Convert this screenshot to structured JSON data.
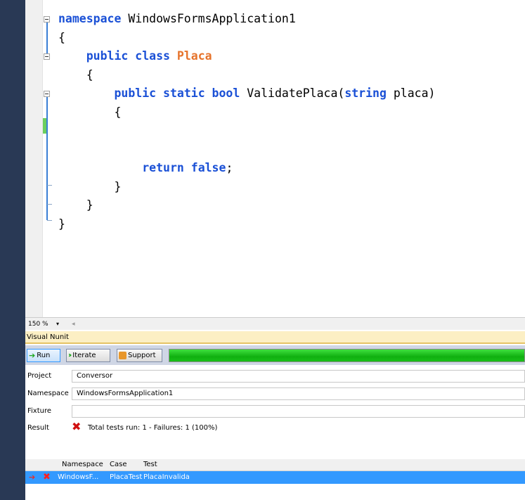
{
  "editor": {
    "code_lines": [
      [
        "namespace",
        " WindowsFormsApplication1"
      ],
      [
        "{"
      ],
      [
        "public class ",
        "Placa"
      ],
      [
        "{"
      ],
      [
        "public static bool ",
        "ValidatePlaca(",
        "string",
        " placa)"
      ],
      [
        "{"
      ],
      [
        ""
      ],
      [
        ""
      ],
      [
        "return false",
        ";"
      ],
      [
        "}"
      ],
      [
        "}"
      ],
      [
        "}"
      ]
    ],
    "line1_kw": "namespace",
    "line1_rest": " WindowsFormsApplication1",
    "brace_open": "{",
    "brace_close": "}",
    "line3_kw": "public class ",
    "line3_cls": "Placa",
    "line5_kw": "public static bool ",
    "line5_name": "ValidatePlaca(",
    "line5_type": "string",
    "line5_param": " placa)",
    "line9_kw": "return false",
    "line9_semi": ";"
  },
  "zoom": {
    "value": "150 %",
    "dropdown": "▾",
    "scroll_left": "◂"
  },
  "panel": {
    "title": "Visual Nunit",
    "buttons": {
      "run": "Run",
      "iterate": "Iterate",
      "support": "Support"
    },
    "progress_fraction": 1.0,
    "progress_color": "#1fc01f",
    "fields": {
      "project_label": "Project",
      "project_value": "Conversor",
      "namespace_label": "Namespace",
      "namespace_value": "WindowsFormsApplication1",
      "fixture_label": "Fixture",
      "fixture_value": "",
      "result_label": "Result",
      "result_text": "Total tests run: 1 - Failures: 1 (100%)"
    },
    "grid": {
      "columns": [
        "Namespace",
        "Case",
        "Test"
      ],
      "rows": [
        {
          "namespace": "WindowsF...",
          "case": "PlacaTest",
          "test": "PlacaInvalida"
        }
      ]
    }
  },
  "colors": {
    "keyword": "#1a50d6",
    "class_name": "#e6732b",
    "selection": "#3399ff",
    "fail": "#d01010"
  },
  "icons": {
    "run": "green-arrow-icon",
    "iterate": "double-arrow-icon",
    "support": "support-icon",
    "fail": "red-x-icon"
  }
}
